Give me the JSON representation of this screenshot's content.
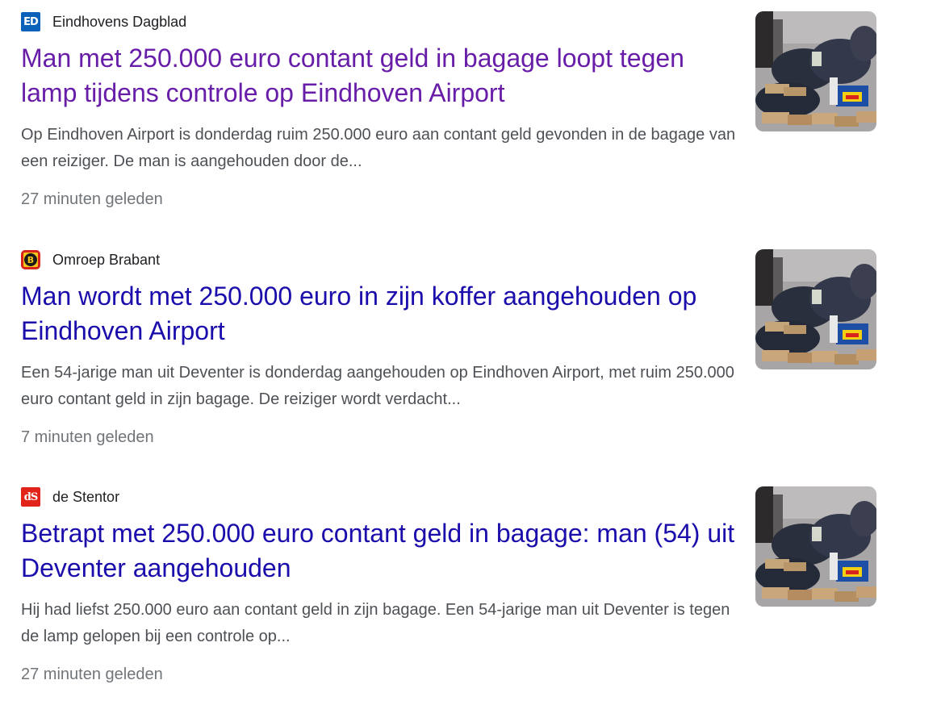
{
  "articles": [
    {
      "source": "Eindhovens Dagblad",
      "logo_icon": "eindhovens-dagblad-logo-icon",
      "logo_text": "ED",
      "headline": "Man met 250.000 euro contant geld in bagage loopt tegen lamp tijdens controle op Eindhoven Airport",
      "headline_color": "#681da8",
      "snippet": "Op Eindhoven Airport is donderdag ruim 250.000 euro aan contant geld gevonden in de bagage van een reiziger. De man is aangehouden door de...",
      "time": "27 minuten geleden"
    },
    {
      "source": "Omroep Brabant",
      "logo_icon": "omroep-brabant-logo-icon",
      "logo_text": "B",
      "headline": "Man wordt met 250.000 euro in zijn koffer aangehouden op Eindhoven Airport",
      "headline_color": "#1a0dab",
      "snippet": "Een 54-jarige man uit Deventer is donderdag aangehouden op Eindhoven Airport, met ruim 250.000 euro contant geld in zijn bagage. De reiziger wordt verdacht...",
      "time": "7 minuten geleden"
    },
    {
      "source": "de Stentor",
      "logo_icon": "de-stentor-logo-icon",
      "logo_text": "dS",
      "headline": "Betrapt met 250.000 euro contant geld in bagage: man (54) uit Deventer aangehouden",
      "headline_color": "#1a0dab",
      "snippet": "Hij had liefst 250.000 euro aan contant geld in zijn bagage. Een 54-jarige man uit Deventer is tegen de lamp gelopen bij een controle op...",
      "time": "27 minuten geleden"
    }
  ],
  "colors": {
    "link_unvisited": "#1a0dab",
    "link_visited": "#681da8",
    "snippet": "#4d5156",
    "timestamp": "#70757a"
  }
}
